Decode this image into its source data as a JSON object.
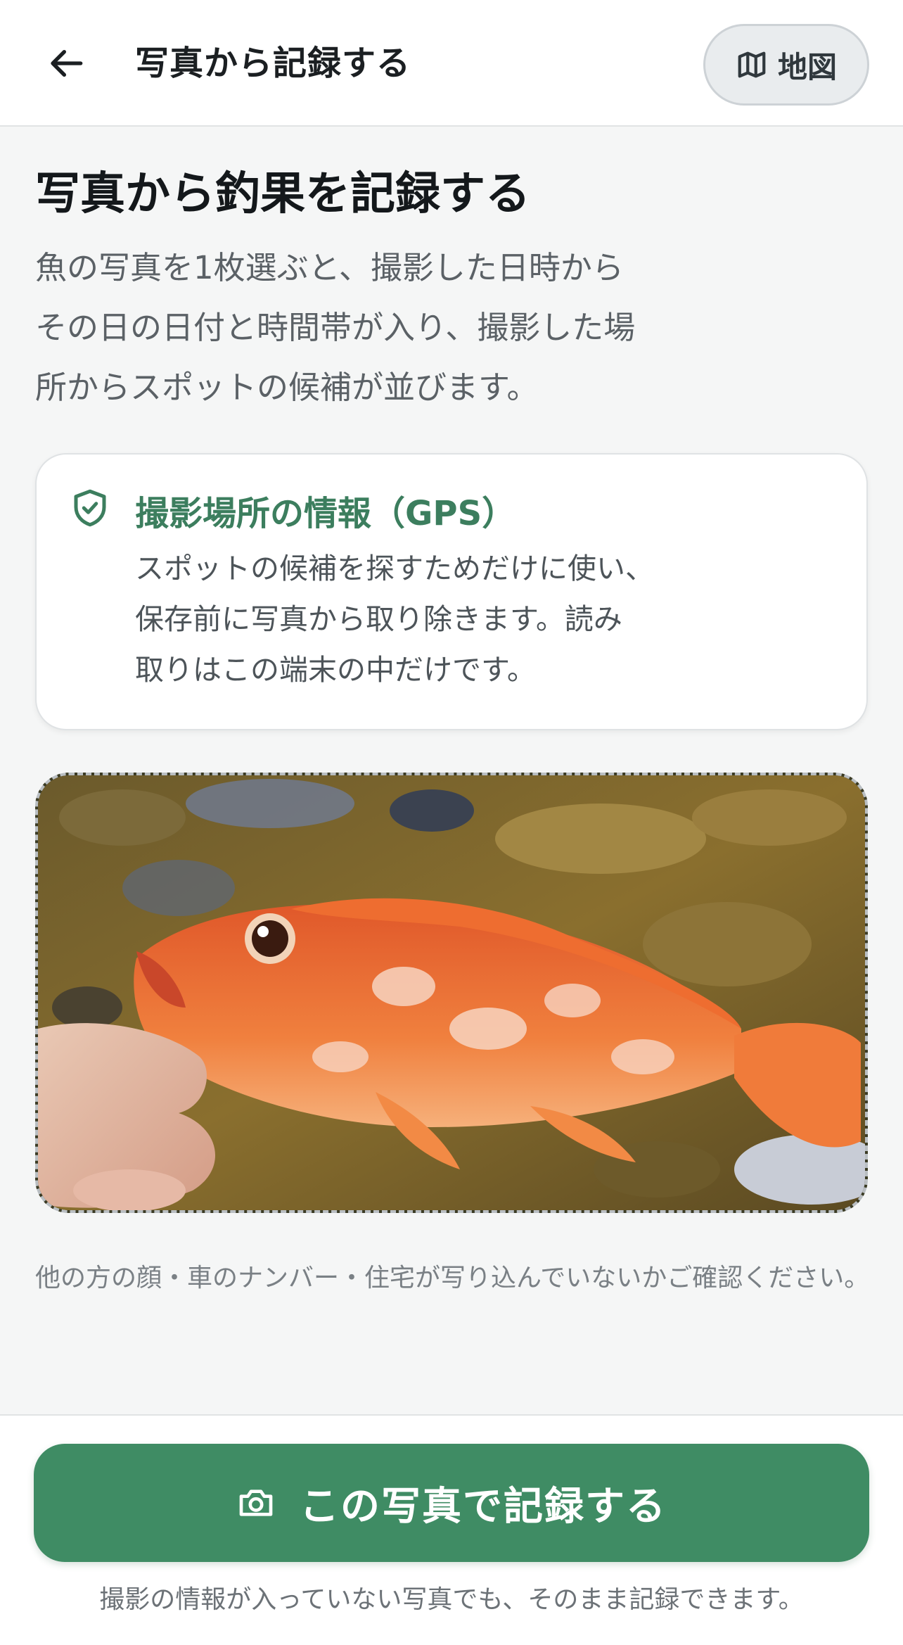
{
  "header": {
    "back_icon": "arrow-left-icon",
    "title": "写真から記録する",
    "map_button": {
      "icon": "map-icon",
      "label": "地図"
    }
  },
  "main": {
    "title": "写真から釣果を記録する",
    "intro_lines": [
      "魚の写真を1枚選ぶと、撮影した日時から",
      "その日の日付と時間帯が入り、撮影した場",
      "所からスポットの候補が並びます。"
    ]
  },
  "gps_card": {
    "icon": "shield-check-icon",
    "title": "撮影場所の情報（GPS）",
    "body_lines": [
      "スポットの候補を探すためだけに使い、",
      "保存前に写真から取り除きます。読み",
      "取りはこの端末の中だけです。"
    ]
  },
  "photo": {
    "subject": "red grouper held in hand over rocky shallow water"
  },
  "notice": "他の方の顔・車のナンバー・住宅が写り込んでいないかご確認ください。",
  "footer": {
    "record_button": {
      "icon": "camera-icon",
      "label": "この写真で記録する"
    },
    "note": "撮影の情報が入っていない写真でも、そのまま記録できます。"
  },
  "colors": {
    "accent_green": "#3f8c64",
    "gps_title_green": "#3c7e5e",
    "background": "#f5f6f6"
  }
}
